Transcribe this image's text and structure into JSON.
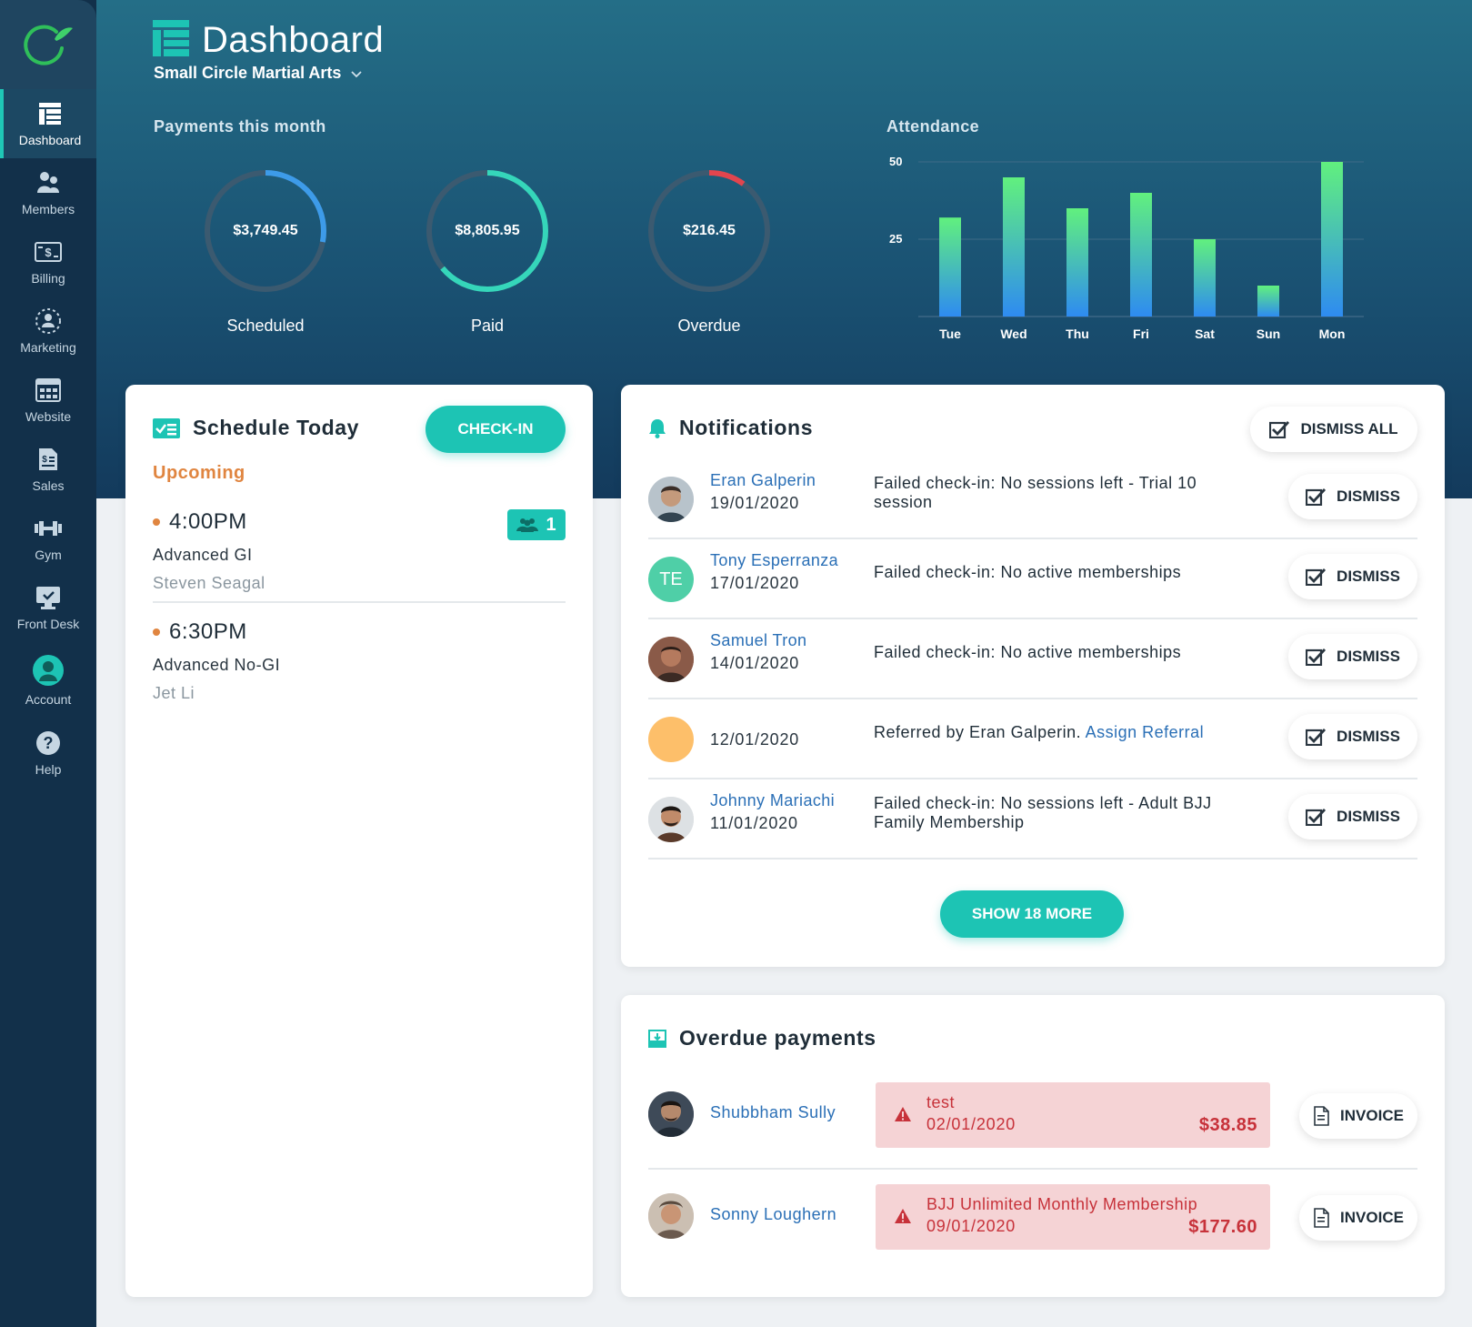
{
  "sidebar": {
    "items": [
      {
        "label": "Dashboard",
        "icon": "dashboard-icon",
        "active": true
      },
      {
        "label": "Members",
        "icon": "members-icon"
      },
      {
        "label": "Billing",
        "icon": "billing-icon"
      },
      {
        "label": "Marketing",
        "icon": "marketing-icon"
      },
      {
        "label": "Website",
        "icon": "website-icon"
      },
      {
        "label": "Sales",
        "icon": "sales-icon"
      },
      {
        "label": "Gym",
        "icon": "gym-icon"
      },
      {
        "label": "Front Desk",
        "icon": "front-desk-icon"
      },
      {
        "label": "Account",
        "icon": "account-icon"
      },
      {
        "label": "Help",
        "icon": "help-icon"
      }
    ]
  },
  "header": {
    "title": "Dashboard",
    "organization": "Small Circle Martial Arts"
  },
  "payments": {
    "label": "Payments this month",
    "items": [
      {
        "label": "Scheduled",
        "value": "$3,749.45",
        "progress": 0.28,
        "color": "#3d9be9"
      },
      {
        "label": "Paid",
        "value": "$8,805.95",
        "progress": 0.64,
        "color": "#35d6ba"
      },
      {
        "label": "Overdue",
        "value": "$216.45",
        "progress": 0.1,
        "color": "#e2454e"
      }
    ]
  },
  "attendance": {
    "label": "Attendance"
  },
  "chart_data": {
    "type": "bar",
    "title": "Attendance",
    "categories": [
      "Tue",
      "Wed",
      "Thu",
      "Fri",
      "Sat",
      "Sun",
      "Mon"
    ],
    "values": [
      32,
      45,
      35,
      40,
      25,
      10,
      50
    ],
    "ylim": [
      0,
      50
    ],
    "yticks": [
      25,
      50
    ],
    "grid": true,
    "colors": [
      "#61f07e",
      "#2e8bf1"
    ]
  },
  "schedule": {
    "title": "Schedule Today",
    "checkin_label": "CHECK-IN",
    "upcoming_label": "Upcoming",
    "items": [
      {
        "time": "4:00PM",
        "class": "Advanced GI",
        "instructor": "Steven Seagal",
        "attendees": "1"
      },
      {
        "time": "6:30PM",
        "class": "Advanced No-GI",
        "instructor": "Jet Li"
      }
    ]
  },
  "notifications": {
    "title": "Notifications",
    "dismiss_all_label": "DISMISS ALL",
    "dismiss_label": "DISMISS",
    "show_more_label": "SHOW 18 MORE",
    "items": [
      {
        "name": "Eran Galperin",
        "date": "19/01/2020",
        "message": "Failed check-in: No sessions left - Trial 10 session"
      },
      {
        "name": "Tony Esperranza",
        "initials": "TE",
        "date": "17/01/2020",
        "message": "Failed check-in: No active memberships"
      },
      {
        "name": "Samuel Tron",
        "date": "14/01/2020",
        "message": "Failed check-in: No active memberships"
      },
      {
        "date": "12/01/2020",
        "message": "Referred by Eran Galperin.",
        "link": "Assign Referral"
      },
      {
        "name": "Johnny Mariachi",
        "date": "11/01/2020",
        "message": "Failed check-in: No sessions left - Adult BJJ Family Membership"
      }
    ]
  },
  "overdue": {
    "title": "Overdue payments",
    "invoice_label": "INVOICE",
    "items": [
      {
        "name": "Shubbham Sully",
        "description": "test",
        "date": "02/01/2020",
        "amount": "$38.85"
      },
      {
        "name": "Sonny Loughern",
        "description": "BJJ Unlimited Monthly Membership",
        "date": "09/01/2020",
        "amount": "$177.60"
      }
    ]
  }
}
